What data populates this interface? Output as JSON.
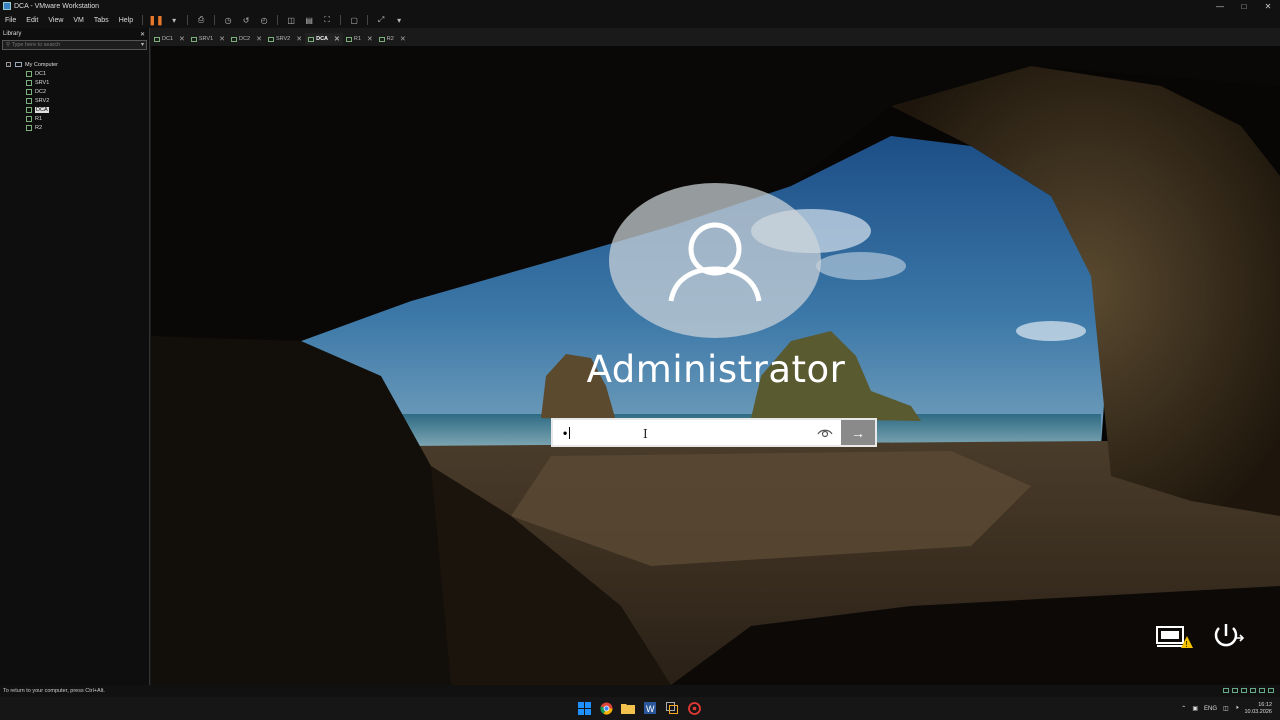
{
  "window": {
    "title": "DCA - VMware Workstation"
  },
  "menu": {
    "items": [
      "File",
      "Edit",
      "View",
      "VM",
      "Tabs",
      "Help"
    ]
  },
  "library": {
    "title": "Library",
    "search_placeholder": "Type here to search",
    "root": "My Computer",
    "vms": [
      "DC1",
      "SRV1",
      "DC2",
      "SRV2",
      "DCA",
      "R1",
      "R2"
    ],
    "selected": "DCA"
  },
  "tabs": [
    {
      "label": "DC1",
      "active": false
    },
    {
      "label": "SRV1",
      "active": false
    },
    {
      "label": "DC2",
      "active": false
    },
    {
      "label": "SRV2",
      "active": false
    },
    {
      "label": "DCA",
      "active": true
    },
    {
      "label": "R1",
      "active": false
    },
    {
      "label": "R2",
      "active": false
    }
  ],
  "login": {
    "username": "Administrator",
    "password_mask": "•"
  },
  "status": {
    "text": "To return to your computer, press Ctrl+Alt."
  },
  "tray": {
    "language": "ENG",
    "time": "16:12",
    "date": "10.03.2026"
  },
  "colors": {
    "pause_accent": "#e8782c",
    "win_blue": "#1e90ff"
  },
  "icons": {
    "vm_screen": [
      "user-avatar-icon",
      "password-reveal-icon",
      "submit-arrow-icon",
      "network-warning-icon",
      "power-icon"
    ],
    "taskbar": [
      "windows-start-icon",
      "chrome-icon",
      "file-explorer-icon",
      "word-icon",
      "vmware-icon",
      "red-app-icon"
    ]
  }
}
